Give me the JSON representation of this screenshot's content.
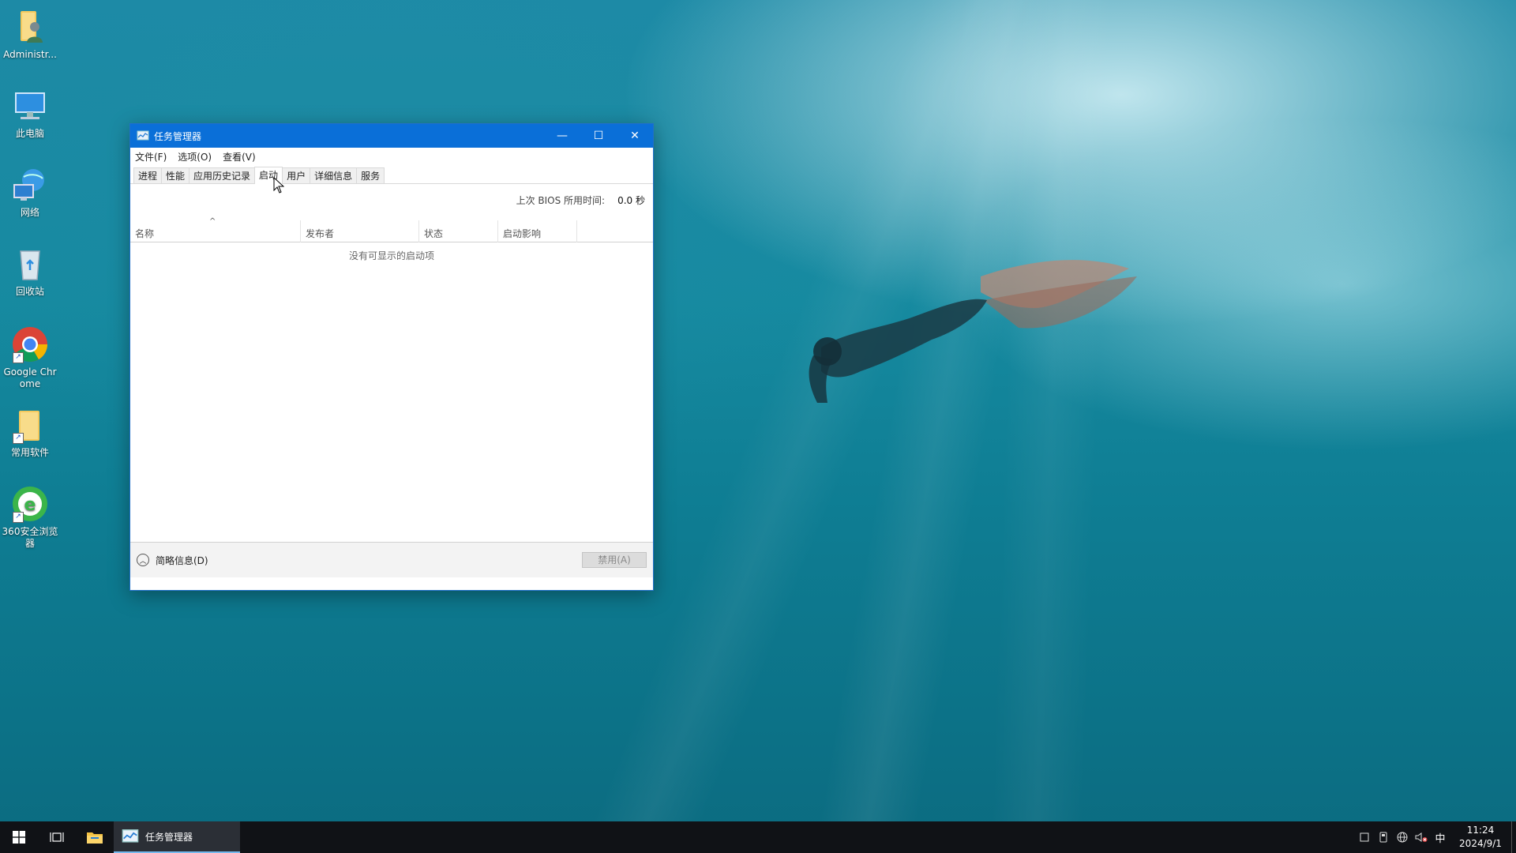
{
  "desktop": {
    "icons": [
      {
        "label": "Administr..."
      },
      {
        "label": "此电脑"
      },
      {
        "label": "网络"
      },
      {
        "label": "回收站"
      },
      {
        "label": "Google Chrome"
      },
      {
        "label": "常用软件"
      },
      {
        "label": "360安全浏览器"
      }
    ]
  },
  "window": {
    "title": "任务管理器",
    "minimize_glyph": "—",
    "maximize_glyph": "☐",
    "close_glyph": "✕",
    "menu": [
      "文件(F)",
      "选项(O)",
      "查看(V)"
    ],
    "tabs": [
      "进程",
      "性能",
      "应用历史记录",
      "启动",
      "用户",
      "详细信息",
      "服务"
    ],
    "active_tab": "启动",
    "bios_label": "上次 BIOS 所用时间:",
    "bios_value": "0.0 秒",
    "columns": [
      "名称",
      "发布者",
      "状态",
      "启动影响"
    ],
    "sort_glyph": "^",
    "empty_text": "没有可显示的启动项",
    "footer": {
      "brief_label": "简略信息(D)",
      "disable_label": "禁用(A)"
    }
  },
  "taskbar": {
    "task_label": "任务管理器",
    "ime": "中",
    "time": "11:24",
    "date": "2024/9/1"
  },
  "colors": {
    "titlebar": "#0a6fd8",
    "taskbar": "#101216",
    "task_active_underline": "#76b9ed"
  }
}
